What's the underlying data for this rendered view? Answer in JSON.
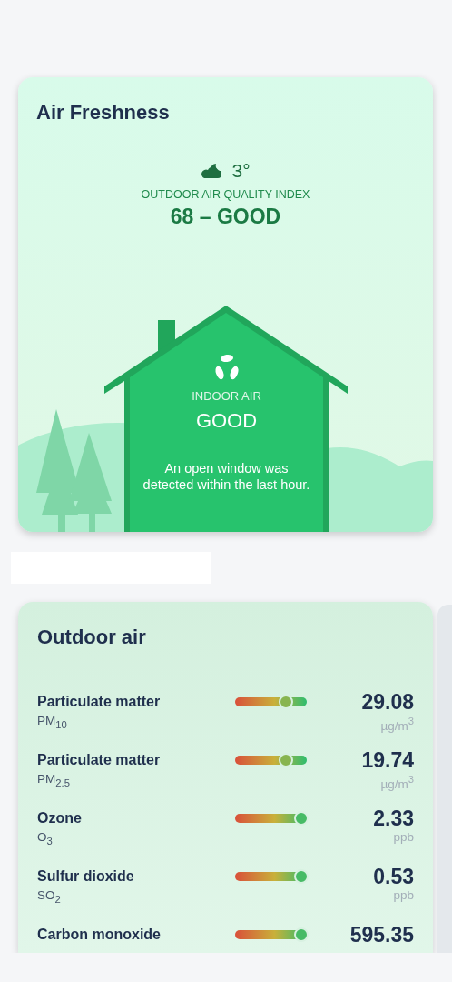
{
  "air_freshness": {
    "title": "Air Freshness",
    "weather": {
      "temperature": "3°"
    },
    "aqi_label": "OUTDOOR AIR QUALITY INDEX",
    "aqi_value": "68 – GOOD",
    "indoor": {
      "label": "INDOOR AIR",
      "status": "GOOD",
      "message": "An open window was detected within the last hour."
    }
  },
  "outdoor_air": {
    "title": "Outdoor air",
    "pollutants": [
      {
        "name": "Particulate matter",
        "formula": "PM$_{10}$",
        "level": 0.71,
        "value": "29.08",
        "unit": "µg/m$^{3}$"
      },
      {
        "name": "Particulate matter",
        "formula": "PM$_{2.5}$",
        "level": 0.71,
        "value": "19.74",
        "unit": "µg/m$^{3}$"
      },
      {
        "name": "Ozone",
        "formula": "O$_{3}$",
        "level": 0.92,
        "value": "2.33",
        "unit": "ppb"
      },
      {
        "name": "Sulfur dioxide",
        "formula": "SO$_{2}$",
        "level": 0.92,
        "value": "0.53",
        "unit": "ppb"
      },
      {
        "name": "Carbon monoxide",
        "level": 0.92,
        "value": "595.35"
      }
    ]
  }
}
